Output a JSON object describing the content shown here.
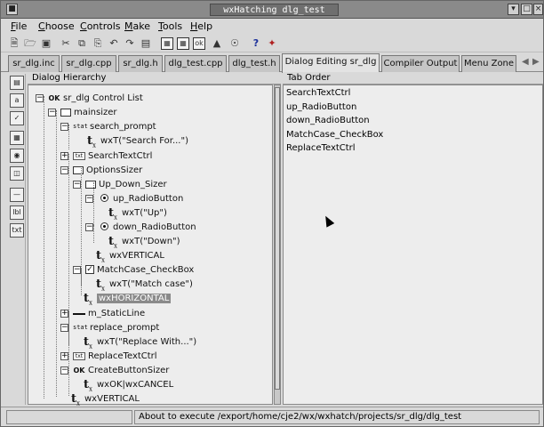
{
  "window": {
    "title": "wxHatching dlg_test"
  },
  "menu": {
    "items": [
      {
        "label": "File",
        "u": "F",
        "rest": "ile"
      },
      {
        "label": "Choose",
        "u": "C",
        "rest": "hoose"
      },
      {
        "label": "Controls",
        "u": "C",
        "rest": "ontrols"
      },
      {
        "label": "Make",
        "u": "M",
        "rest": "ake"
      },
      {
        "label": "Tools",
        "u": "T",
        "rest": "ools"
      },
      {
        "label": "Help",
        "u": "H",
        "rest": "elp"
      }
    ]
  },
  "toolbar": {
    "icons": [
      "new-file-icon",
      "open-folder-icon",
      "save-icon",
      "cut-icon",
      "copy-icon",
      "paste-icon",
      "undo-icon",
      "redo-icon",
      "rename-icon",
      "dialog-icon",
      "grid-icon",
      "ok-icon",
      "run-icon",
      "help-icon",
      "wizard-icon"
    ]
  },
  "tabs": {
    "items": [
      "sr_dlg.inc",
      "sr_dlg.cpp",
      "sr_dlg.h",
      "dlg_test.cpp",
      "dlg_test.h",
      "Dialog Editing sr_dlg",
      "Compiler Output",
      "Menu Zone"
    ],
    "active_index": 5
  },
  "sidebar": {
    "icons": [
      "dialog-tool-icon",
      "static-text-tool-icon",
      "checkbox-tool-icon",
      "grid-tool-icon",
      "radio-tool-icon",
      "sizer-tool-icon",
      "line-tool-icon",
      "label-tool-icon",
      "textctrl-tool-icon"
    ]
  },
  "hierarchy": {
    "header": "Dialog Hierarchy",
    "nodes": [
      {
        "label": "sr_dlg Control List",
        "icon": "ok"
      },
      {
        "label": "mainsizer",
        "icon": "folder"
      },
      {
        "label": "search_prompt",
        "icon": "stat",
        "icon_text": "stat"
      },
      {
        "label": "wxT(\"Search For...\")",
        "icon": "tx"
      },
      {
        "label": "SearchTextCtrl",
        "icon": "text"
      },
      {
        "label": "OptionsSizer",
        "icon": "folder"
      },
      {
        "label": "Up_Down_Sizer",
        "icon": "folder"
      },
      {
        "label": "up_RadioButton",
        "icon": "radio"
      },
      {
        "label": "wxT(\"Up\")",
        "icon": "tx"
      },
      {
        "label": "down_RadioButton",
        "icon": "radio"
      },
      {
        "label": "wxT(\"Down\")",
        "icon": "tx"
      },
      {
        "label": "wxVERTICAL",
        "icon": "tx"
      },
      {
        "label": "MatchCase_CheckBox",
        "icon": "check"
      },
      {
        "label": "wxT(\"Match case\")",
        "icon": "tx"
      },
      {
        "label": "wxHORIZONTAL",
        "icon": "tx"
      },
      {
        "label": "m_StaticLine",
        "icon": "line"
      },
      {
        "label": "replace_prompt",
        "icon": "stat",
        "icon_text": "stat"
      },
      {
        "label": "wxT(\"Replace With...\")",
        "icon": "tx"
      },
      {
        "label": "ReplaceTextCtrl",
        "icon": "text"
      },
      {
        "label": "CreateButtonSizer",
        "icon": "ok"
      },
      {
        "label": "wxOK|wxCANCEL",
        "icon": "tx"
      },
      {
        "label": "wxVERTICAL",
        "icon": "tx"
      }
    ],
    "selected_label": "wxHORIZONTAL"
  },
  "tab_order": {
    "header": "Tab Order",
    "items": [
      "SearchTextCtrl",
      "up_RadioButton",
      "down_RadioButton",
      "MatchCase_CheckBox",
      "ReplaceTextCtrl"
    ]
  },
  "status": {
    "message": "About to execute /export/home/cje2/wx/wxhatch/projects/sr_dlg/dlg_test"
  }
}
